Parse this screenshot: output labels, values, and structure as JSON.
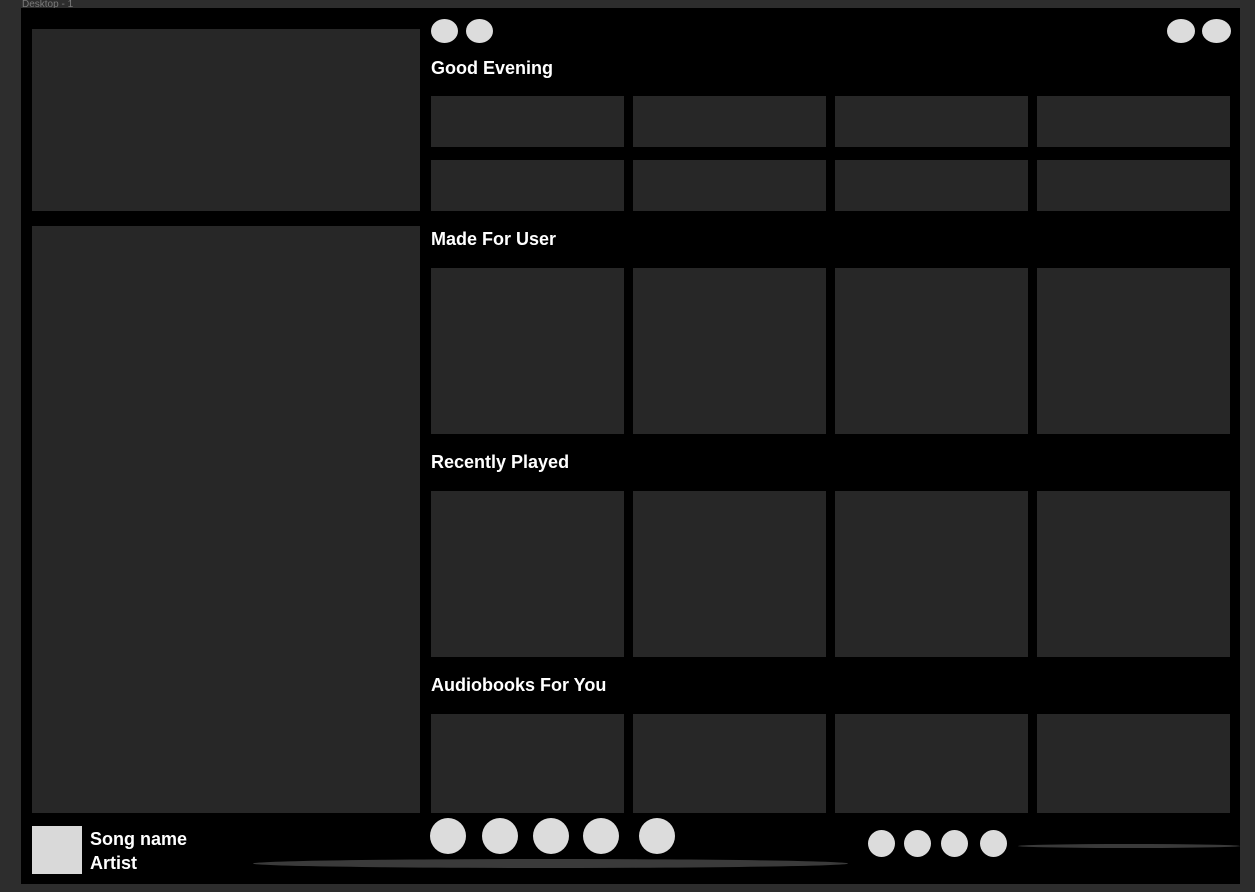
{
  "frame": {
    "label": "Desktop - 1"
  },
  "nav": {
    "back_icon": "back-circle",
    "forward_icon": "forward-circle"
  },
  "header_right": {
    "icons": [
      "notification-circle",
      "profile-circle"
    ]
  },
  "sections": [
    {
      "title": "Good Evening"
    },
    {
      "title": "Made For User"
    },
    {
      "title": "Recently Played"
    },
    {
      "title": "Audiobooks For You"
    }
  ],
  "player": {
    "song_name": "Song name",
    "artist": "Artist",
    "controls": [
      "shuffle-circle",
      "previous-circle",
      "play-circle",
      "next-circle",
      "repeat-circle"
    ],
    "extra_controls": [
      "queue-circle",
      "device-circle",
      "volume-circle",
      "mic-circle"
    ]
  },
  "colors": {
    "background": "#000000",
    "panel": "#272727",
    "placeholder": "#dcdcdc",
    "text": "#ffffff"
  }
}
